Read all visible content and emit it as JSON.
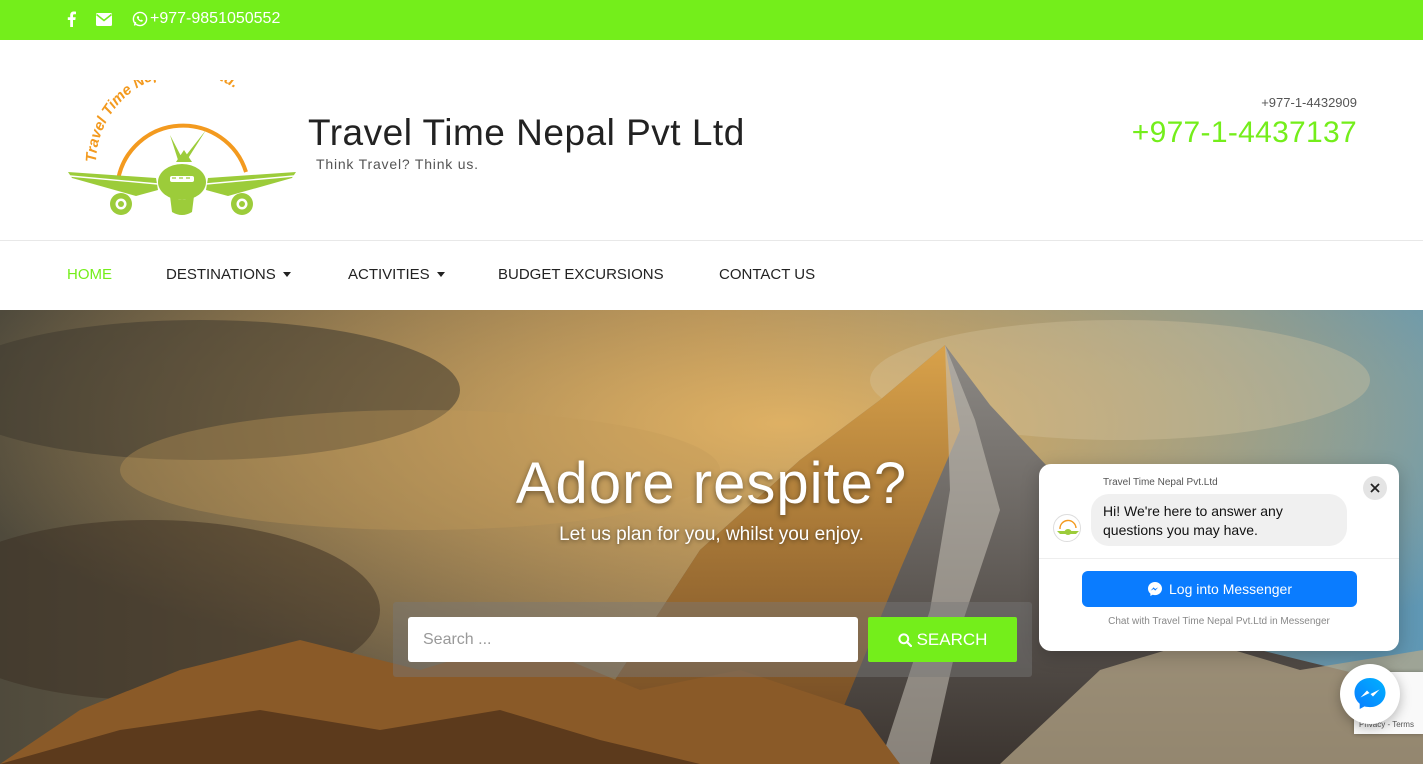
{
  "topbar": {
    "phone": "+977-9851050552",
    "icons": [
      "facebook-icon",
      "envelope-icon",
      "whatsapp-icon"
    ],
    "background": "#74ee1b"
  },
  "header": {
    "logo_arc_text": "Travel Time Nepal Pvt. Ltd.",
    "title": "Travel Time Nepal Pvt Ltd",
    "tagline": "Think Travel? Think us.",
    "phone_secondary": "+977-1-4432909",
    "phone_primary": "+977-1-4437137"
  },
  "nav": {
    "items": [
      {
        "label": "HOME",
        "active": true,
        "has_dropdown": false
      },
      {
        "label": "DESTINATIONS",
        "active": false,
        "has_dropdown": true
      },
      {
        "label": "ACTIVITIES",
        "active": false,
        "has_dropdown": true
      },
      {
        "label": "BUDGET EXCURSIONS",
        "active": false,
        "has_dropdown": false
      },
      {
        "label": "CONTACT US",
        "active": false,
        "has_dropdown": false
      }
    ]
  },
  "hero": {
    "title": "Adore respite?",
    "subtitle": "Let us plan for you, whilst you enjoy.",
    "search_placeholder": "Search ...",
    "search_button": "SEARCH"
  },
  "messenger": {
    "page_name": "Travel Time Nepal Pvt.Ltd",
    "greeting": "Hi! We're here to answer any questions you may have.",
    "login_button": "Log into Messenger",
    "footer": "Chat with Travel Time Nepal Pvt.Ltd in Messenger",
    "accent": "#0a7cff"
  },
  "recaptcha": {
    "text": "Privacy - Terms"
  },
  "colors": {
    "brand_green": "#74ee1b",
    "logo_orange": "#f39a1f",
    "logo_green": "#9ccc3a"
  }
}
